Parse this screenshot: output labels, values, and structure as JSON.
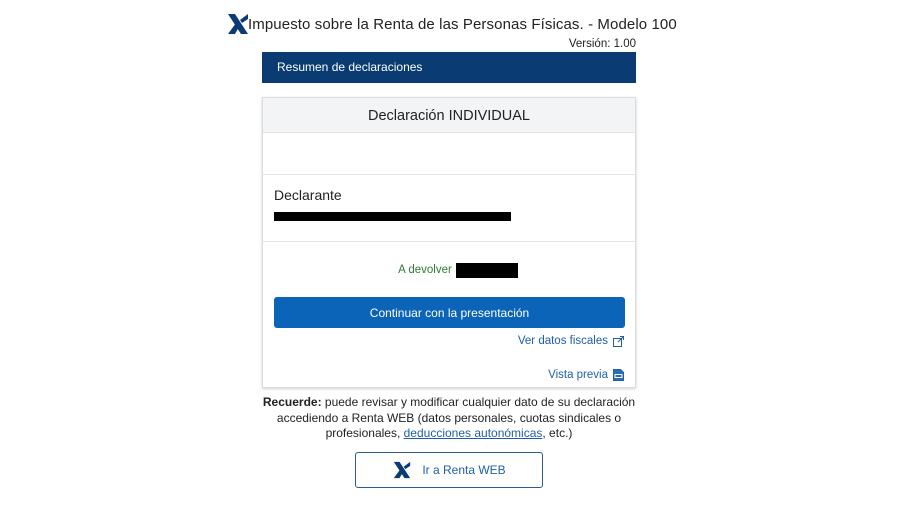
{
  "header": {
    "title": "Impuesto sobre la Renta de las Personas Físicas. - Modelo 100",
    "version": "Versión: 1.00",
    "logo_icon": "aeat-logo-icon"
  },
  "summary_bar": {
    "label": "Resumen de declaraciones"
  },
  "card": {
    "title": "Declaración INDIVIDUAL",
    "declarant_label": "Declarante",
    "refund_label": "A devolver",
    "continue_label": "Continuar con la presentación",
    "fiscal_link_label": "Ver datos fiscales",
    "fiscal_link_icon": "external-link-icon",
    "preview_link_label": "Vista previa",
    "preview_link_icon": "pdf-icon"
  },
  "reminder": {
    "bold": "Recuerde:",
    "text_1": " puede revisar y modificar cualquier dato de su declaración accediendo a Renta WEB (datos personales, cuotas sindicales o profesionales, ",
    "link": "deducciones autonómicas",
    "text_2": ", etc.)"
  },
  "renta_web_button": {
    "label": "Ir a Renta WEB",
    "icon": "aeat-logo-icon"
  },
  "colors": {
    "primary_dark": "#0a3c73",
    "primary_button": "#0b64b8",
    "link": "#1f5fa8",
    "refund_green": "#2e7d32"
  }
}
